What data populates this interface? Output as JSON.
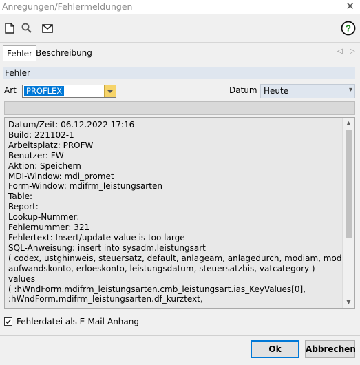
{
  "window": {
    "title": "Anregungen/Fehlermeldungen",
    "close_glyph": "✕"
  },
  "toolbar": {
    "icons": [
      "new-document-icon",
      "search-icon",
      "mail-icon"
    ],
    "help_icon": "help-icon"
  },
  "tabs": [
    {
      "label": "Fehler",
      "active": true
    },
    {
      "label": "Beschreibung",
      "active": false
    }
  ],
  "section": {
    "title": "Fehler"
  },
  "form": {
    "art_label": "Art",
    "art_value": "PROFLEX",
    "datum_label": "Datum",
    "datum_value": "Heute"
  },
  "error_text": [
    "Datum/Zeit: 06.12.2022 17:16",
    "Build: 221102-1",
    "Arbeitsplatz: PROFW",
    "Benutzer: FW",
    "Aktion: Speichern",
    "MDI-Window: mdi_promet",
    "Form-Window: mdifrm_leistungsarten",
    "Table:",
    "Report:",
    "Lookup-Nummer:",
    "Fehlernummer: 321",
    "Fehlertext: Insert/update value is too large",
    "SQL-Anweisung: insert into sysadm.leistungsart",
    "( codex, ustghinweis, steuersatz, default, anlageam, anlagedurch, modiam, modidurch,",
    "aufwandskonto, erloeskonto, leistungsdatum, steuersatzbis, vatcategory )",
    "values",
    "( :hWndForm.mdifrm_leistungsarten.cmb_leistungsart.ias_KeyValues[0],",
    ":hWndForm.mdifrm_leistungsarten.df_kurztext,"
  ],
  "attachment": {
    "label": "Fehlerdatei als E-Mail-Anhang",
    "checked": true
  },
  "buttons": {
    "ok": "Ok",
    "cancel": "Abbrechen"
  },
  "colors": {
    "selection": "#0078d7",
    "section_bg": "#dfe6ef",
    "dropdown_accent": "#f6d46a"
  }
}
